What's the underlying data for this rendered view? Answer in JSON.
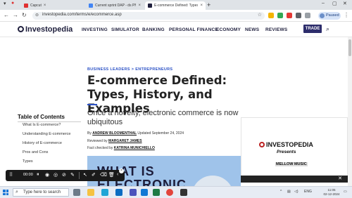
{
  "browser": {
    "tabs": [
      {
        "label": "Capcut",
        "favicon_color": "#e03131",
        "active": false
      },
      {
        "label": "Current sprint DAP - ds PM hic...",
        "favicon_color": "#4285f4",
        "active": false
      },
      {
        "label": "E-commerce Defined: Types, Hi...",
        "favicon_color": "#1f1f3d",
        "active": true
      }
    ],
    "new_tab_glyph": "+",
    "url": "investopedia.com/terms/e/ecommerce.asp",
    "profile_label": "Paused"
  },
  "site": {
    "logo": "Investopedia",
    "nav": [
      "INVESTING",
      "SIMULATOR",
      "BANKING",
      "PERSONAL FINANCE",
      "ECONOMY",
      "NEWS",
      "REVIEWS"
    ],
    "trade_button": "TRADE",
    "accent_color": "#2c52c6",
    "trade_color": "#2c2c6b"
  },
  "article": {
    "breadcrumbs": [
      "BUSINESS LEADERS",
      "ENTREPRENEURS"
    ],
    "breadcrumb_separator": ">",
    "title": "E-commerce Defined: Types, History, and Examples",
    "subtitle": "Once a novelty, electronic commerce is now ubiquitous",
    "by_prefix": "By",
    "author": "ANDREW BLOOMENTHAL",
    "updated": "Updated September 24, 2024",
    "reviewed_prefix": "Reviewed by",
    "reviewer": "MARGARET JAMES",
    "factcheck_prefix": "Fact checked by",
    "factchecker": "KATRINA MUNICHIELLO",
    "hero_text": "WHAT IS ELECTRONIC"
  },
  "toc": {
    "heading": "Table of Contents",
    "items": [
      "What Is E-commerce?",
      "Understanding E-commerce",
      "History of E-commerce",
      "Pros and Cons",
      "Types"
    ]
  },
  "ad": {
    "logo": "INVESTOPEDIA",
    "presents": "Presents",
    "show": "MELLOW MUSIC",
    "close": "✕"
  },
  "recorder": {
    "time": "00:00",
    "close": "×"
  },
  "taskbar": {
    "search_placeholder": "Type here to search",
    "tray_lang": "ENG",
    "time": "11:05",
    "date": "02-12-2024"
  }
}
